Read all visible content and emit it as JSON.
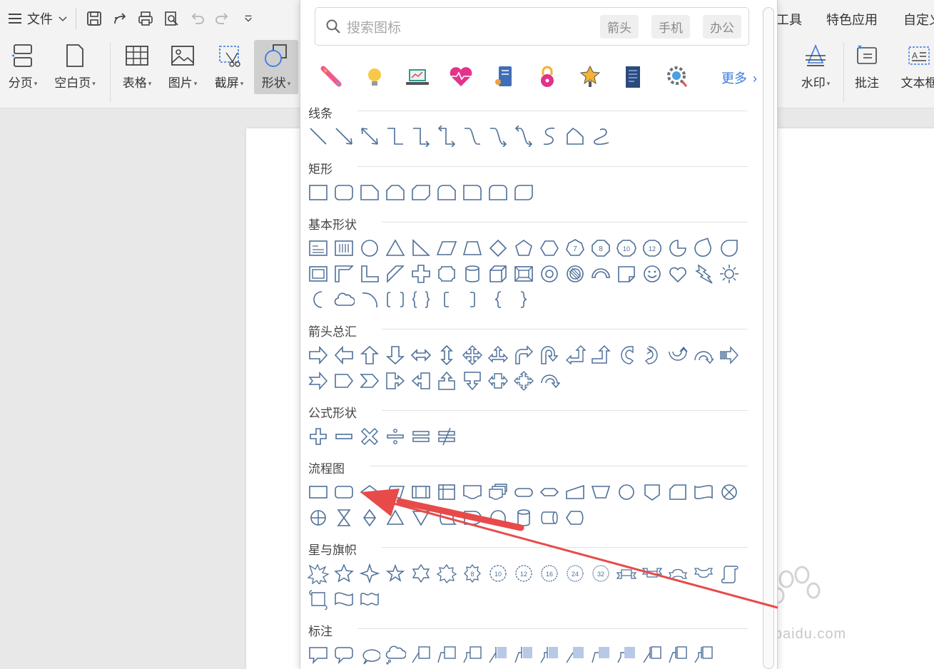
{
  "ribbon": {
    "file_menu": "文件",
    "buttons": {
      "page": "分页",
      "blank": "空白页",
      "table": "表格",
      "picture": "图片",
      "screenshot": "截屏",
      "shape": "形状",
      "watermark": "水印",
      "comment": "批注",
      "textbox": "文本框"
    },
    "right_top": {
      "tools": "工具",
      "special": "特色应用",
      "custom": "自定义"
    }
  },
  "panel": {
    "search_placeholder": "搜索图标",
    "tags": [
      "箭头",
      "手机",
      "办公"
    ],
    "more_label": "更多",
    "sections": [
      {
        "title": "线条"
      },
      {
        "title": "矩形"
      },
      {
        "title": "基本形状"
      },
      {
        "title": "箭头总汇"
      },
      {
        "title": "公式形状"
      },
      {
        "title": "流程图"
      },
      {
        "title": "星与旗帜"
      },
      {
        "title": "标注"
      }
    ],
    "colored_icons": [
      "rocket-icon",
      "bulb-icon",
      "laptop-chart-icon",
      "heart-pulse-icon",
      "notebook-icon",
      "lock-icon",
      "trophy-icon",
      "document-icon",
      "gear-search-icon"
    ]
  },
  "watermark": {
    "text": "jingyan.baidu.com",
    "logo": "Baidu经验"
  },
  "colors": {
    "shape_stroke": "#4e6f98",
    "accent": "#3a7be0",
    "arrow": "#e84a4a"
  }
}
